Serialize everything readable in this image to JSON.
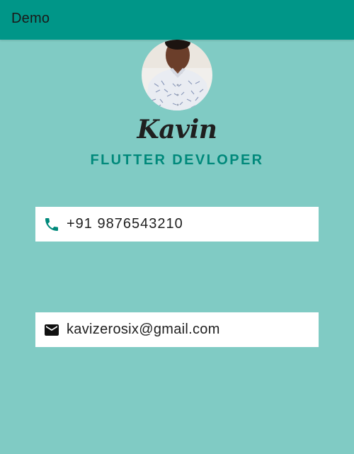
{
  "app_bar": {
    "title": "Demo"
  },
  "profile": {
    "name": "Kavin",
    "role": "FLUTTER DEVLOPER"
  },
  "contacts": {
    "phone": {
      "icon": "phone-icon",
      "value": "+91 9876543210"
    },
    "email": {
      "icon": "email-icon",
      "value": "kavizerosix@gmail.com"
    }
  },
  "colors": {
    "app_bar": "#009688",
    "background": "#80cbc4",
    "accent": "#00897b",
    "card": "#ffffff"
  }
}
